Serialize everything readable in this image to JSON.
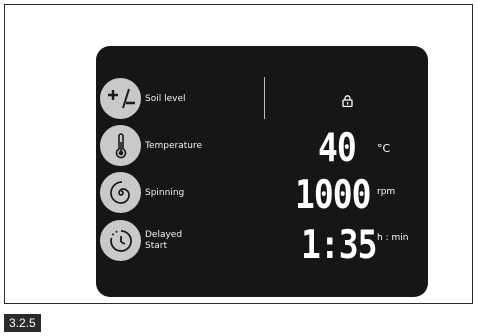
{
  "panel": {
    "buttons": [
      {
        "label": "Soil level",
        "icon": "plus-minus-icon"
      },
      {
        "label": "Temperature",
        "icon": "thermometer-icon"
      },
      {
        "label": "Spinning",
        "icon": "spiral-icon"
      },
      {
        "label": "Delayed\nStart",
        "icon": "clock-icon"
      }
    ],
    "lock_icon": "lock-icon",
    "display": {
      "temperature_value": "40",
      "temperature_unit": "°C",
      "spin_value": "1000",
      "spin_unit": "rpm",
      "delay_value": "1:35",
      "delay_unit": "h : min"
    }
  },
  "section_number": "3.2.5",
  "colors": {
    "panel_bg": "#161616",
    "button_bg": "#c9c9c9",
    "section_bg": "#2b2b2b"
  }
}
